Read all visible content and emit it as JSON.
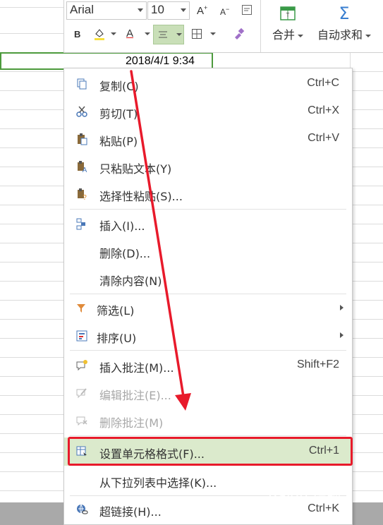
{
  "cell": {
    "value": "2018/4/1 9:34"
  },
  "toolbar": {
    "font_name": "Arial",
    "font_size": "10",
    "grow_font": "A",
    "shrink_font": "A",
    "bold": "B",
    "font_color_letter": "A",
    "merge_label": "合并",
    "autosum_label": "自动求和",
    "sum_symbol": "Σ"
  },
  "menu": {
    "copy": {
      "label": "复制(C)",
      "shortcut": "Ctrl+C"
    },
    "cut": {
      "label": "剪切(T)",
      "shortcut": "Ctrl+X"
    },
    "paste": {
      "label": "粘贴(P)",
      "shortcut": "Ctrl+V"
    },
    "paste_text": {
      "label": "只粘贴文本(Y)"
    },
    "paste_special": {
      "label": "选择性粘贴(S)..."
    },
    "insert": {
      "label": "插入(I)..."
    },
    "delete": {
      "label": "删除(D)..."
    },
    "clear": {
      "label": "清除内容(N)"
    },
    "filter": {
      "label": "筛选(L)"
    },
    "sort": {
      "label": "排序(U)"
    },
    "insert_comment": {
      "label": "插入批注(M)...",
      "shortcut": "Shift+F2"
    },
    "edit_comment": {
      "label": "编辑批注(E)..."
    },
    "delete_comment": {
      "label": "删除批注(M)"
    },
    "format_cells": {
      "label": "设置单元格格式(F)...",
      "shortcut": "Ctrl+1"
    },
    "pick_list": {
      "label": "从下拉列表中选择(K)..."
    },
    "hyperlink": {
      "label": "超链接(H)...",
      "shortcut": "Ctrl+K"
    }
  },
  "colors": {
    "highlight": "#dbeacc",
    "annotation": "#e81a2b",
    "selection": "#4c9a3c"
  },
  "watermark": "Baidu 经验"
}
